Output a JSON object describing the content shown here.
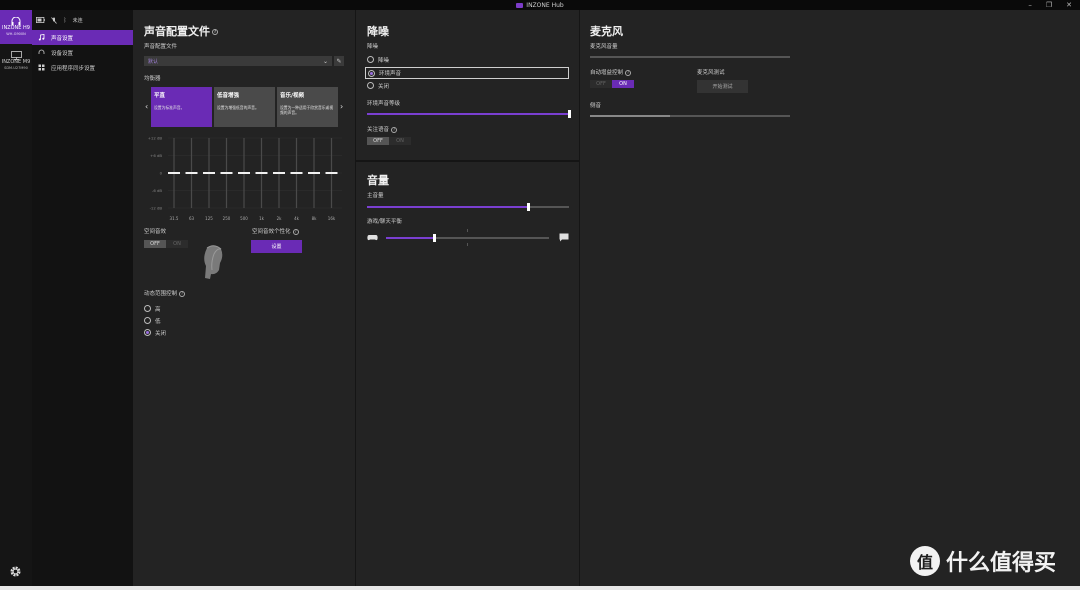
{
  "window": {
    "title": "INZONE Hub",
    "controls": [
      "–",
      "❐",
      "✕"
    ]
  },
  "devices": [
    {
      "model": "INZONE H9",
      "sub": "WH-G900N",
      "active": true
    },
    {
      "model": "INZONE M9",
      "sub": "SDM-U27M90",
      "active": false
    }
  ],
  "status": {
    "label": "未连"
  },
  "nav": [
    {
      "label": "声音设置",
      "active": true
    },
    {
      "label": "设备设置",
      "active": false
    },
    {
      "label": "应用程序同步设置",
      "active": false
    }
  ],
  "sound": {
    "title": "声音配置文件",
    "profile_label": "声音配置文件",
    "profile_value": "默认",
    "eq_label": "均衡器",
    "presets": [
      {
        "title": "平直",
        "desc": "设置为标准声音。"
      },
      {
        "title": "低音增强",
        "desc": "设置为增强低音的声音。"
      },
      {
        "title": "音乐/视频",
        "desc": "设置为一种适用于欣赏音乐或视频的声音。"
      }
    ],
    "eq_db": [
      "+12 dB",
      "+6 dB",
      "0",
      "-6 dB",
      "-12 dB"
    ],
    "eq_freqs": [
      "31.5",
      "63",
      "125",
      "250",
      "500",
      "1k",
      "2k",
      "4k",
      "8k",
      "16k"
    ],
    "spatial_label": "空间音效",
    "spatial_personal_label": "空间音效个性化",
    "spatial_off": "OFF",
    "spatial_on": "ON",
    "setup_button": "设置",
    "drc_label": "动态范围控制",
    "drc_options": [
      "高",
      "低",
      "关闭"
    ],
    "drc_selected": 2
  },
  "nc": {
    "title": "降噪",
    "mode_label": "降噪",
    "options": [
      "降噪",
      "环境声音",
      "关闭"
    ],
    "selected": 1,
    "ambient_label": "环境声音等级",
    "ambient_level": 1.0,
    "focus_label": "关注语音",
    "focus_off": "OFF",
    "focus_on": "ON"
  },
  "volume": {
    "title": "音量",
    "master_label": "主音量",
    "master_level": 0.8,
    "balance_label": "游戏/聊天平衡",
    "balance_level": 0.3
  },
  "mic": {
    "title": "麦克风",
    "volume_label": "麦克风音量",
    "auto_gain_label": "自动增益控制",
    "auto_off": "OFF",
    "auto_on": "ON",
    "test_label": "麦克风测试",
    "test_button": "开始测试",
    "sidetone_label": "侧音",
    "sidetone_level": 0.4
  },
  "watermark": {
    "logo": "值",
    "text": "什么值得买"
  },
  "icons": {
    "headset": "headset-icon",
    "monitor": "monitor-icon",
    "battery": "battery-icon",
    "mic_muted": "mic-muted-icon",
    "bluetooth": "bluetooth-icon",
    "gear": "gear-icon",
    "music": "music-note-icon",
    "headphones": "headphones-icon",
    "sync": "sync-icon",
    "gamepad": "gamepad-icon",
    "chat": "chat-icon"
  },
  "colors": {
    "accent": "#6a2bb5",
    "accent_light": "#7a3fd1"
  }
}
